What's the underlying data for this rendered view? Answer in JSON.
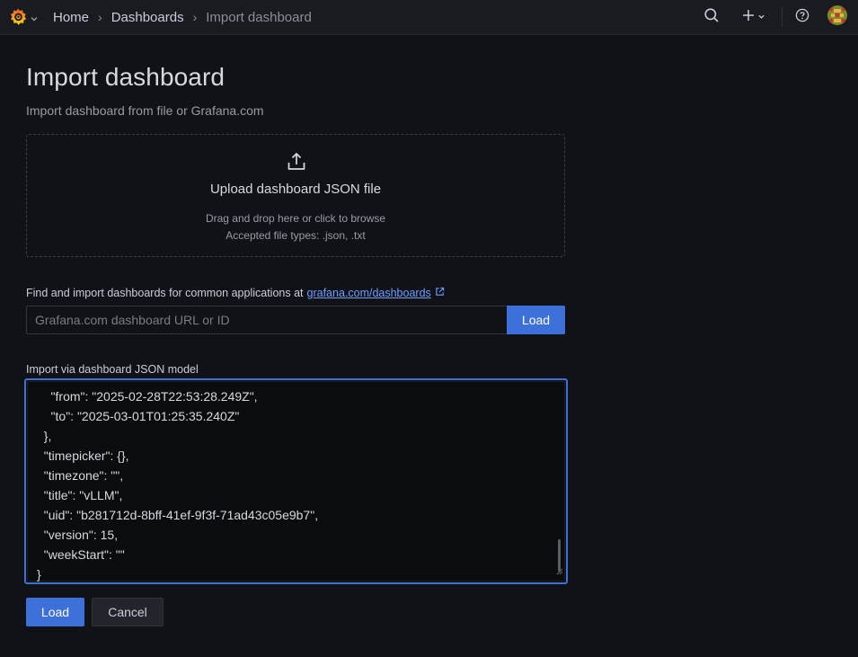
{
  "header": {
    "logo_icon": "grafana-logo-icon",
    "breadcrumbs": [
      "Home",
      "Dashboards",
      "Import dashboard"
    ],
    "icons": [
      "search-icon",
      "plus-icon",
      "chevron-down-icon",
      "help-icon",
      "avatar"
    ]
  },
  "page": {
    "title": "Import dashboard",
    "subtitle": "Import dashboard from file or Grafana.com"
  },
  "upload": {
    "icon": "upload-icon",
    "title": "Upload dashboard JSON file",
    "hint_line1": "Drag and drop here or click to browse",
    "hint_line2": "Accepted file types: .json, .txt"
  },
  "grafana_com": {
    "label": "Find and import dashboards for common applications at",
    "link_text": "grafana.com/dashboards",
    "input_placeholder": "Grafana.com dashboard URL or ID",
    "input_value": "",
    "load_label": "Load"
  },
  "json_model": {
    "label": "Import via dashboard JSON model",
    "lines": [
      "    \"from\": \"2025-02-28T22:53:28.249Z\",",
      "    \"to\": \"2025-03-01T01:25:35.240Z\"",
      "  },",
      "  \"timepicker\": {},",
      "  \"timezone\": \"\",",
      "  \"title\": \"vLLM\",",
      "  \"uid\": \"b281712d-8bff-41ef-9f3f-71ad43c05e9b7\",",
      "  \"version\": 15,",
      "  \"weekStart\": \"\"",
      "}"
    ]
  },
  "actions": {
    "load_label": "Load",
    "cancel_label": "Cancel"
  },
  "colors": {
    "accent": "#3d71d9",
    "link": "#6e9fff",
    "background": "#111217"
  }
}
